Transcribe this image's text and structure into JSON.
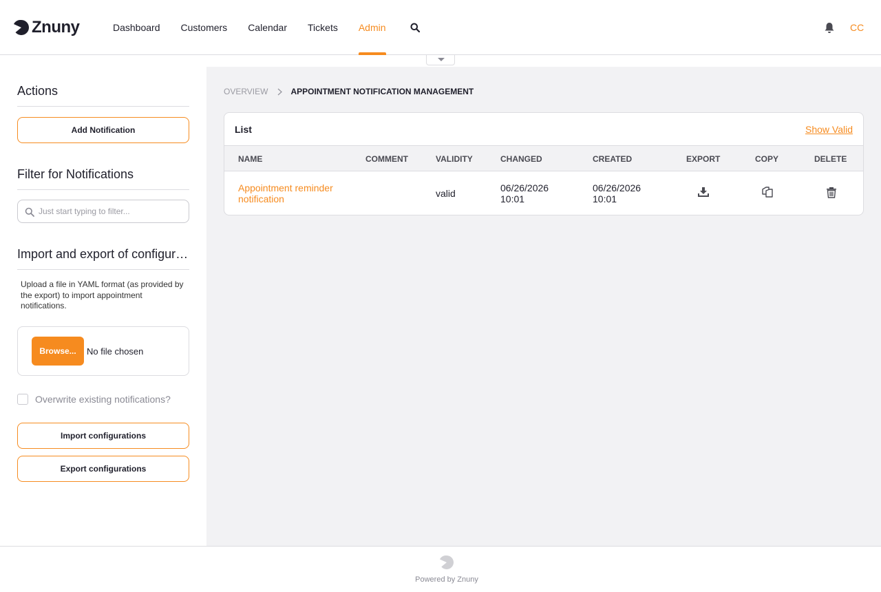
{
  "app": {
    "brand": "Znuny",
    "accent_color": "#f68b1f",
    "user_initials": "CC"
  },
  "nav": {
    "items": [
      {
        "label": "Dashboard"
      },
      {
        "label": "Customers"
      },
      {
        "label": "Calendar"
      },
      {
        "label": "Tickets"
      },
      {
        "label": "Admin",
        "active": true
      }
    ]
  },
  "sidebar": {
    "actions_heading": "Actions",
    "add_button": "Add Notification",
    "filter_heading": "Filter for Notifications",
    "filter_placeholder": "Just start typing to filter...",
    "import_heading": "Import and export of configurations",
    "import_description": "Upload a file in YAML format (as provided by the export) to import appointment notifications.",
    "browse_button": "Browse...",
    "file_status": "No file chosen",
    "overwrite_label": "Overwrite existing notifications?",
    "overwrite_checked": false,
    "import_button": "Import configurations",
    "export_button": "Export configurations"
  },
  "breadcrumb": {
    "overview": "OVERVIEW",
    "current": "APPOINTMENT NOTIFICATION MANAGEMENT"
  },
  "list": {
    "title": "List",
    "show_valid": "Show Valid",
    "columns": [
      "NAME",
      "COMMENT",
      "VALIDITY",
      "CHANGED",
      "CREATED",
      "EXPORT",
      "COPY",
      "DELETE"
    ],
    "rows": [
      {
        "name": "Appointment reminder notification",
        "comment": "",
        "validity": "valid",
        "changed": "06/26/2026 10:01",
        "created": "06/26/2026 10:01",
        "icons": [
          "download-icon",
          "copy-icon",
          "trash-icon"
        ]
      }
    ]
  },
  "footer": {
    "powered_by": "Powered by Znuny"
  }
}
